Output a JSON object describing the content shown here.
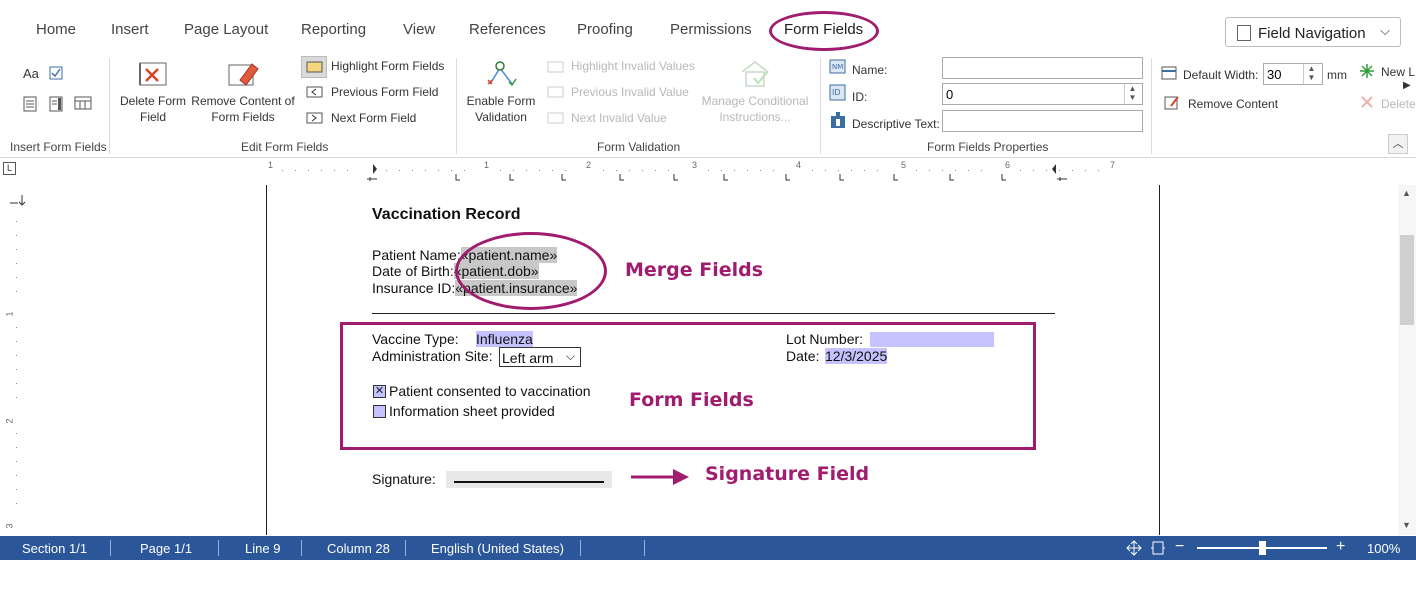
{
  "tabs": [
    {
      "label": "Home"
    },
    {
      "label": "Insert"
    },
    {
      "label": "Page Layout"
    },
    {
      "label": "Reporting"
    },
    {
      "label": "View"
    },
    {
      "label": "References"
    },
    {
      "label": "Proofing"
    },
    {
      "label": "Permissions"
    },
    {
      "label": "Form Fields"
    }
  ],
  "field_navigation": {
    "label": "Field Navigation"
  },
  "ribbon": {
    "insert_form_fields": {
      "label": "Insert Form Fields",
      "aa": "Aa"
    },
    "edit_form_fields": {
      "label": "Edit Form Fields",
      "delete_line1": "Delete Form",
      "delete_line2": "Field",
      "remove_line1": "Remove Content of",
      "remove_line2": "Form Fields",
      "highlight": "Highlight Form Fields",
      "previous": "Previous Form Field",
      "next": "Next Form Field"
    },
    "form_validation": {
      "label": "Form Validation",
      "enable_line1": "Enable Form",
      "enable_line2": "Validation",
      "highlight_invalid": "Highlight Invalid Values",
      "previous_invalid": "Previous Invalid Value",
      "next_invalid": "Next Invalid Value",
      "manage_line1": "Manage Conditional",
      "manage_line2": "Instructions..."
    },
    "form_fields_properties": {
      "label": "Form Fields Properties",
      "name_label": "Name:",
      "name_value": "",
      "id_label": "ID:",
      "id_value": "0",
      "desc_label": "Descriptive Text:",
      "desc_value": ""
    },
    "right_group": {
      "default_width_label": "Default Width:",
      "default_width_value": "30",
      "unit": "mm",
      "remove_content": "Remove Content",
      "new_label": "New L",
      "delete_label": "Delete"
    }
  },
  "ruler": {
    "numbers": [
      "1",
      "1",
      "2",
      "3",
      "4",
      "5",
      "6",
      "7"
    ],
    "corner": "L"
  },
  "vruler": {
    "numbers": [
      "1",
      "2",
      "3"
    ]
  },
  "document": {
    "title": "Vaccination Record",
    "patient_name_label": "Patient Name:",
    "patient_name_field": "«patient.name»",
    "dob_label": "Date of Birth:",
    "dob_field": "«patient.dob»",
    "insurance_label": "Insurance ID:",
    "insurance_field": "«patient.insurance»",
    "vaccine_type_label": "Vaccine Type:",
    "vaccine_type_value": "Influenza",
    "admin_site_label": "Administration Site:",
    "admin_site_value": "Left arm",
    "lot_number_label": "Lot Number:",
    "lot_number_value": "",
    "date_label": "Date:",
    "date_value": "12/3/2025",
    "consent_label": "Patient consented to vaccination",
    "consent_checked": true,
    "info_label": "Information sheet provided",
    "info_checked": false,
    "signature_label": "Signature:"
  },
  "annotations": {
    "merge_fields": "Merge Fields",
    "form_fields": "Form Fields",
    "signature_field": "Signature Field"
  },
  "status_bar": {
    "section": "Section 1/1",
    "page": "Page 1/1",
    "line": "Line 9",
    "column": "Column 28",
    "language": "English (United States)",
    "zoom": "100%",
    "zoom_fraction": 0.5
  },
  "colors": {
    "annotation": "#a01c6e",
    "statusbar": "#2b579a",
    "form_field_shading": "#c5c3ff",
    "merge_field_shading": "#c8c8c8"
  }
}
